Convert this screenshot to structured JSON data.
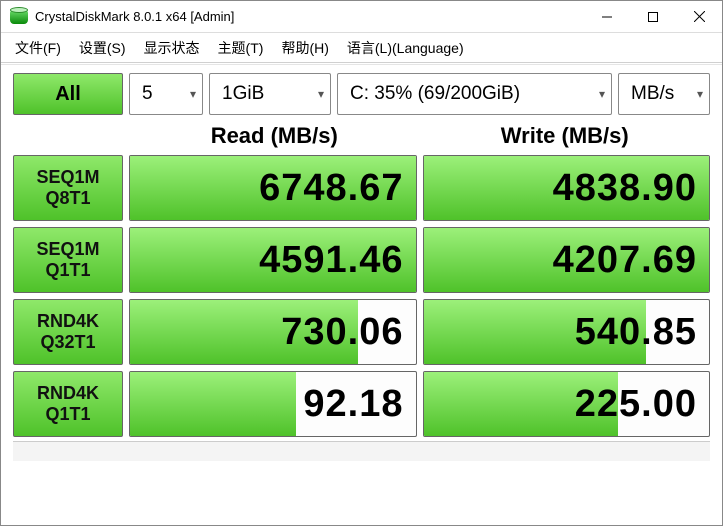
{
  "window": {
    "title": "CrystalDiskMark 8.0.1 x64 [Admin]"
  },
  "menu": {
    "file": "文件(F)",
    "settings": "设置(S)",
    "display": "显示状态",
    "theme": "主题(T)",
    "help": "帮助(H)",
    "language": "语言(L)(Language)"
  },
  "selectors": {
    "all_label": "All",
    "count": "5",
    "size": "1GiB",
    "drive": "C: 35% (69/200GiB)",
    "unit": "MB/s"
  },
  "columns": {
    "read": "Read (MB/s)",
    "write": "Write (MB/s)"
  },
  "tests": [
    {
      "label1": "SEQ1M",
      "label2": "Q8T1",
      "read": "6748.67",
      "read_pct": 100,
      "write": "4838.90",
      "write_pct": 100
    },
    {
      "label1": "SEQ1M",
      "label2": "Q1T1",
      "read": "4591.46",
      "read_pct": 100,
      "write": "4207.69",
      "write_pct": 100
    },
    {
      "label1": "RND4K",
      "label2": "Q32T1",
      "read": "730.06",
      "read_pct": 80,
      "write": "540.85",
      "write_pct": 78
    },
    {
      "label1": "RND4K",
      "label2": "Q1T1",
      "read": "92.18",
      "read_pct": 58,
      "write": "225.00",
      "write_pct": 68
    }
  ]
}
